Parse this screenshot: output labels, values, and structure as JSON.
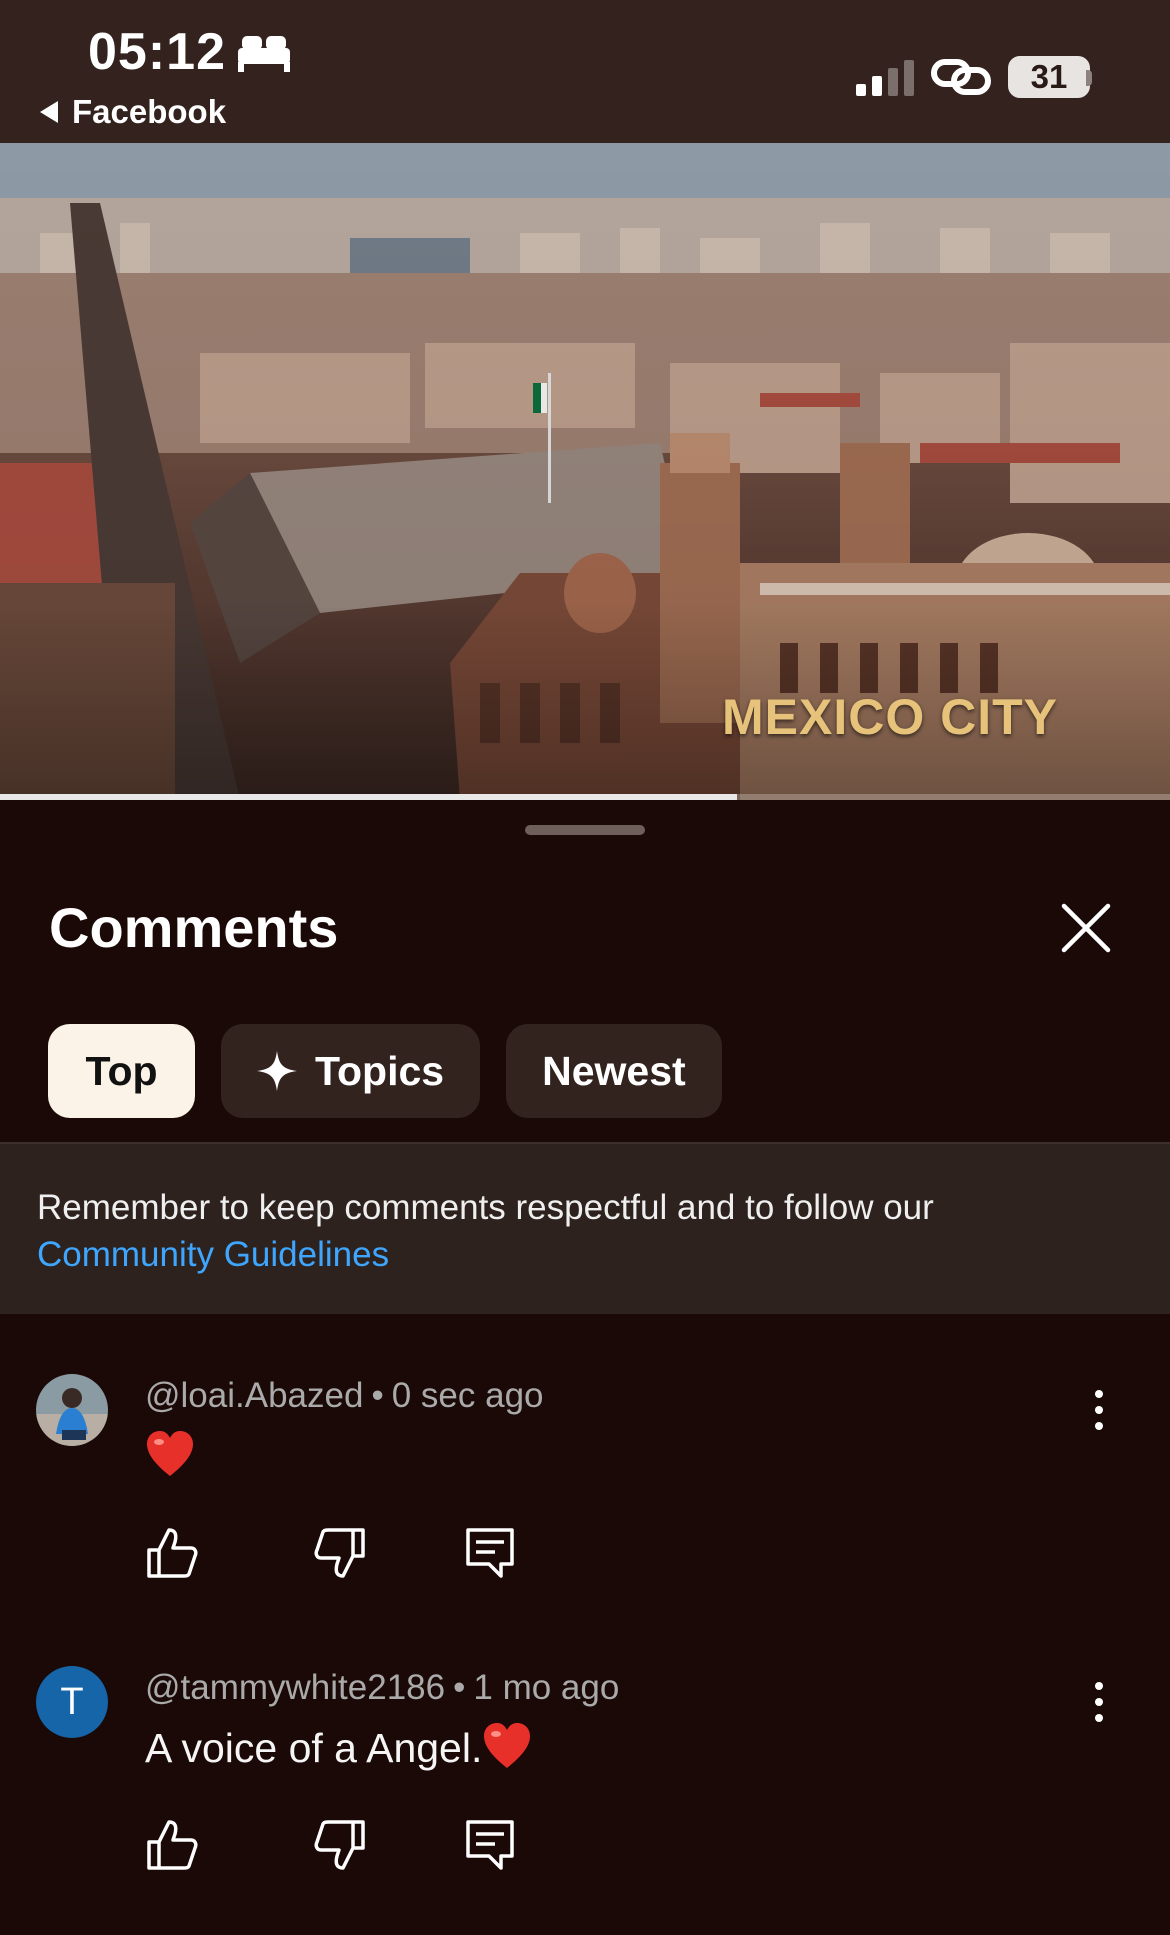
{
  "status_bar": {
    "time": "05:12",
    "back_app_label": "Facebook",
    "battery_level": "31",
    "icons": [
      "bed-icon",
      "signal-icon",
      "link-icon",
      "battery-icon"
    ]
  },
  "video": {
    "caption": "MEXICO CITY",
    "progress": 0.63
  },
  "sheet": {
    "title": "Comments",
    "chips": [
      {
        "label": "Top",
        "active": true
      },
      {
        "label": "Topics",
        "active": false,
        "icon": "sparkle-icon"
      },
      {
        "label": "Newest",
        "active": false
      }
    ],
    "guidelines_text": "Remember to keep comments respectful and to follow our",
    "guidelines_link": "Community Guidelines"
  },
  "comments": [
    {
      "author": "@loai.Abazed",
      "separator": "•",
      "time": "0 sec ago",
      "text": "",
      "emoji": "heart",
      "avatar": "photo"
    },
    {
      "author": "@tammywhite2186",
      "separator": "•",
      "time": "1 mo ago",
      "text": "A voice of a Angel.",
      "emoji": "heart",
      "avatar_letter": "T",
      "avatar_color": "#1565a8"
    }
  ],
  "colors": {
    "background": "#1a0907",
    "status_bar": "#33221d",
    "chip_bg": "#33231f",
    "chip_active_bg": "#fbf3e8",
    "link": "#3ea6ff",
    "caption_gold": "#e6c27a"
  }
}
